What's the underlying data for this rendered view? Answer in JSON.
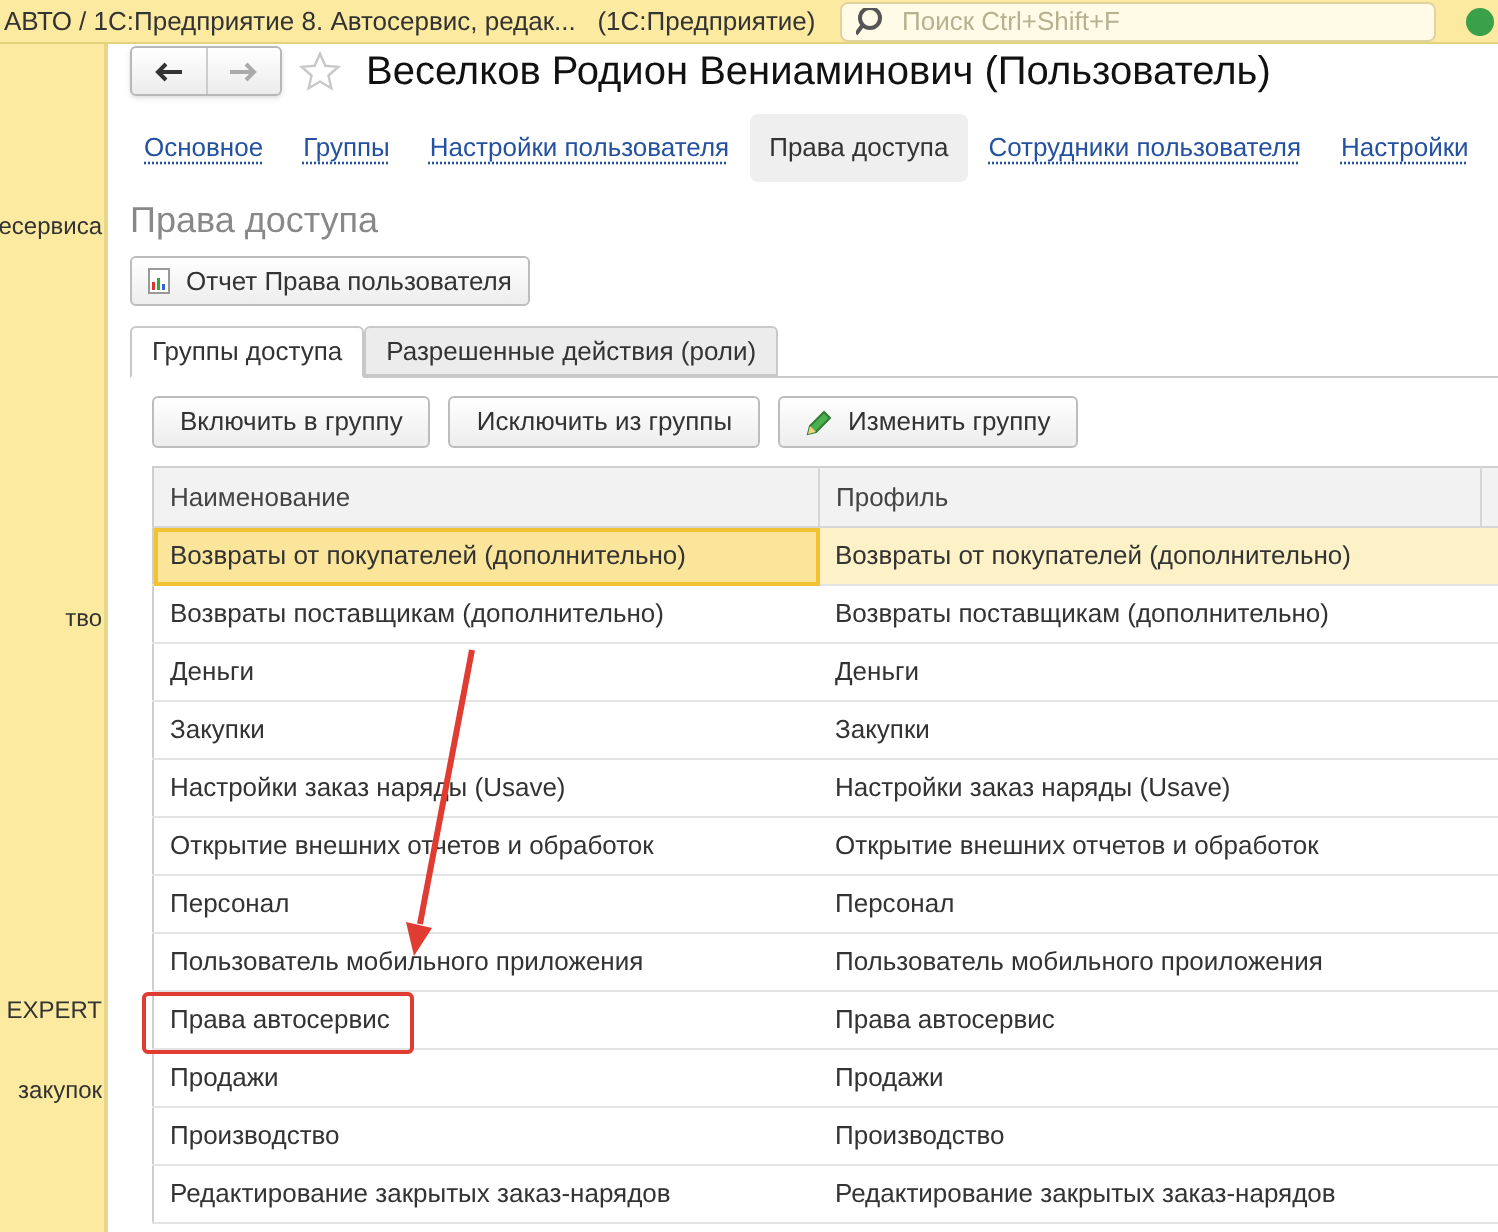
{
  "top_bar": {
    "title": "АВТО / 1С:Предприятие 8. Автосервис, редак...   (1С:Предприятие)",
    "search": {
      "placeholder": "Поиск Ctrl+Shift+F"
    }
  },
  "sidebar": {
    "items": [
      "есервиса",
      "тво",
      "EXPERT",
      "закупок"
    ]
  },
  "window": {
    "title": "Веселков Родион Вениаминович (Пользователь)"
  },
  "nav_tabs": [
    {
      "label": "Основное",
      "selected": false
    },
    {
      "label": "Группы",
      "selected": false
    },
    {
      "label": "Настройки пользователя",
      "selected": false
    },
    {
      "label": "Права доступа",
      "selected": true
    },
    {
      "label": "Сотрудники пользователя",
      "selected": false
    },
    {
      "label": "Настройки",
      "selected": false
    }
  ],
  "section_title": "Права доступа",
  "report_button": "Отчет Права пользователя",
  "tabs": [
    {
      "label": "Группы доступа",
      "selected": true
    },
    {
      "label": "Разрешенные действия (роли)",
      "selected": false
    }
  ],
  "toolbar": [
    {
      "label": "Включить в группу",
      "kind": "plain"
    },
    {
      "label": "Исключить из группы",
      "kind": "plain"
    },
    {
      "label": "Изменить группу",
      "kind": "edit"
    }
  ],
  "table": {
    "columns": [
      "Наименование",
      "Профиль"
    ],
    "rows": [
      {
        "cells": [
          "Возвраты от покупателей (дополнительно)",
          "Возвраты от покупателей (дополнительно)"
        ],
        "selected": true,
        "highlighted": false
      },
      {
        "cells": [
          "Возвраты поставщикам (дополнительно)",
          "Возвраты поставщикам (дополнительно)"
        ],
        "selected": false,
        "highlighted": false
      },
      {
        "cells": [
          "Деньги",
          "Деньги"
        ],
        "selected": false,
        "highlighted": false
      },
      {
        "cells": [
          "Закупки",
          "Закупки"
        ],
        "selected": false,
        "highlighted": false
      },
      {
        "cells": [
          "Настройки заказ наряды (Usave)",
          "Настройки заказ наряды (Usave)"
        ],
        "selected": false,
        "highlighted": false
      },
      {
        "cells": [
          "Открытие внешних отчетов и обработок",
          "Открытие внешних отчетов и обработок"
        ],
        "selected": false,
        "highlighted": false
      },
      {
        "cells": [
          "Персонал",
          "Персонал"
        ],
        "selected": false,
        "highlighted": false
      },
      {
        "cells": [
          "Пользователь мобильного приложения",
          "Пользователь мобильного проиложения"
        ],
        "selected": false,
        "highlighted": false
      },
      {
        "cells": [
          "Права автосервис",
          "Права автосервис"
        ],
        "selected": false,
        "highlighted": true
      },
      {
        "cells": [
          "Продажи",
          "Продажи"
        ],
        "selected": false,
        "highlighted": false
      },
      {
        "cells": [
          "Производство",
          "Производство"
        ],
        "selected": false,
        "highlighted": false
      },
      {
        "cells": [
          "Редактирование закрытых заказ-нарядов",
          "Редактирование закрытых заказ-нарядов"
        ],
        "selected": false,
        "highlighted": false
      }
    ]
  }
}
